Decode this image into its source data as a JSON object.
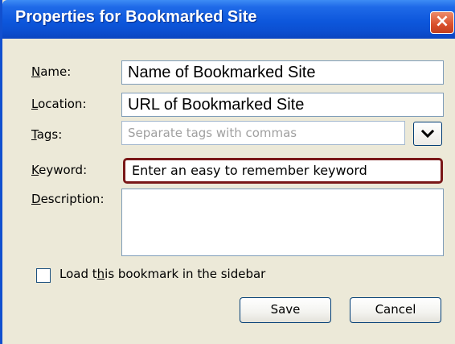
{
  "window": {
    "title_prefix": "Properties for",
    "title_site": "Bookmarked Site",
    "close_glyph": "×",
    "colors": {
      "titlebar": "#0b4fd1",
      "close": "#d94f2b",
      "keyword_highlight": "#7a1818"
    }
  },
  "form": {
    "name": {
      "label_access": "N",
      "label_rest": "ame:",
      "value": "Name of Bookmarked Site"
    },
    "location": {
      "label_access": "L",
      "label_rest": "ocation:",
      "value": "URL of Bookmarked Site"
    },
    "tags": {
      "label_access": "T",
      "label_rest": "ags:",
      "placeholder": "Separate tags with commas",
      "toggle_icon": "chevron-down-icon"
    },
    "keyword": {
      "label_access": "K",
      "label_rest": "eyword:",
      "value": "Enter an easy to remember keyword"
    },
    "description": {
      "label_access": "D",
      "label_rest": "escription:",
      "value": ""
    },
    "sidebar_checkbox": {
      "label_pre": "Load t",
      "label_access": "h",
      "label_post": "is bookmark in the sidebar",
      "checked": false
    }
  },
  "buttons": {
    "save": "Save",
    "cancel": "Cancel"
  }
}
